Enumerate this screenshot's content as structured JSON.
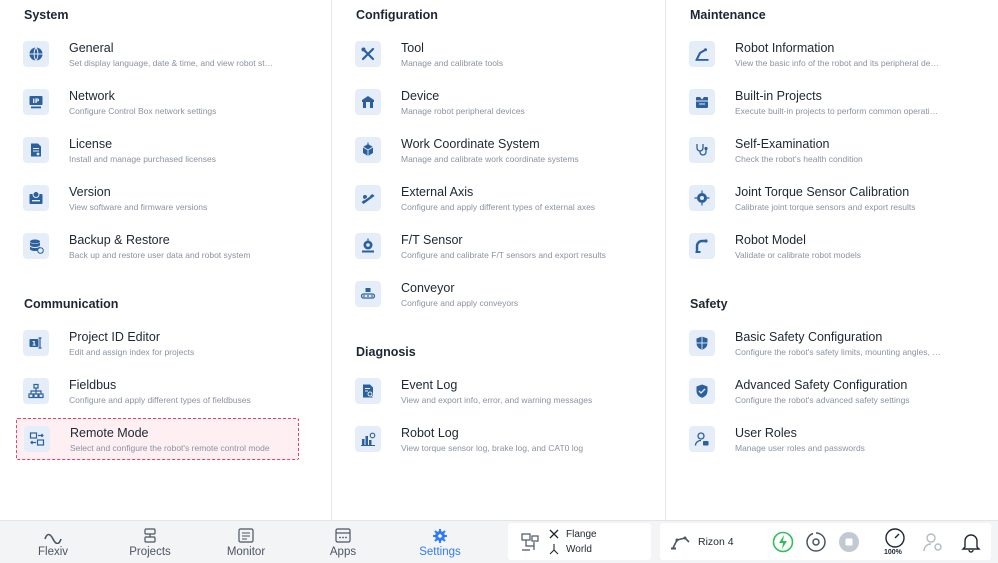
{
  "sections": {
    "system": {
      "title": "System",
      "items": [
        {
          "title": "General",
          "desc": "Set display language, date & time, and view robot st…"
        },
        {
          "title": "Network",
          "desc": "Configure Control Box network settings"
        },
        {
          "title": "License",
          "desc": "Install and manage purchased licenses"
        },
        {
          "title": "Version",
          "desc": "View software and firmware versions"
        },
        {
          "title": "Backup & Restore",
          "desc": "Back up and restore user data and robot system"
        }
      ]
    },
    "communication": {
      "title": "Communication",
      "items": [
        {
          "title": "Project ID Editor",
          "desc": "Edit and assign index for projects"
        },
        {
          "title": "Fieldbus",
          "desc": "Configure and apply different types of fieldbuses"
        },
        {
          "title": "Remote Mode",
          "desc": "Select and configure the robot's remote control mode"
        }
      ]
    },
    "configuration": {
      "title": "Configuration",
      "items": [
        {
          "title": "Tool",
          "desc": "Manage and calibrate tools"
        },
        {
          "title": "Device",
          "desc": "Manage robot peripheral devices"
        },
        {
          "title": "Work Coordinate System",
          "desc": "Manage and calibrate work coordinate systems"
        },
        {
          "title": "External Axis",
          "desc": "Configure and apply different types of external axes"
        },
        {
          "title": "F/T Sensor",
          "desc": "Configure and calibrate F/T sensors and export results"
        },
        {
          "title": "Conveyor",
          "desc": "Configure and apply conveyors"
        }
      ]
    },
    "diagnosis": {
      "title": "Diagnosis",
      "items": [
        {
          "title": "Event Log",
          "desc": "View and export info, error, and warning messages"
        },
        {
          "title": "Robot Log",
          "desc": "View torque sensor log, brake log, and CAT0 log"
        }
      ]
    },
    "maintenance": {
      "title": "Maintenance",
      "items": [
        {
          "title": "Robot Information",
          "desc": "View the basic info of the robot and its peripheral de…"
        },
        {
          "title": "Built-in Projects",
          "desc": "Execute built-in projects to perform common operati…"
        },
        {
          "title": "Self-Examination",
          "desc": "Check the robot's health condition"
        },
        {
          "title": "Joint Torque Sensor Calibration",
          "desc": "Calibrate joint torque sensors and export results"
        },
        {
          "title": "Robot Model",
          "desc": "Validate or calibrate robot models"
        }
      ]
    },
    "safety": {
      "title": "Safety",
      "items": [
        {
          "title": "Basic Safety Configuration",
          "desc": "Configure the robot's safety limits, mounting angles, …"
        },
        {
          "title": "Advanced Safety Configuration",
          "desc": "Configure the robot's advanced safety settings"
        },
        {
          "title": "User Roles",
          "desc": "Manage user roles and passwords"
        }
      ]
    }
  },
  "nav": {
    "flexiv": "Flexiv",
    "projects": "Projects",
    "monitor": "Monitor",
    "apps": "Apps",
    "settings": "Settings"
  },
  "status": {
    "tcp_frame": "Flange",
    "ref_frame": "World",
    "robot_name": "Rizon 4",
    "speed": "100%"
  },
  "colors": {
    "accent": "#2f7df6",
    "icon_blue": "#2c5f9e",
    "icon_bg": "#e4edf8",
    "active_bg": "#fdeff2",
    "active_border": "#e0436a",
    "power_green": "#2fbf5a"
  }
}
